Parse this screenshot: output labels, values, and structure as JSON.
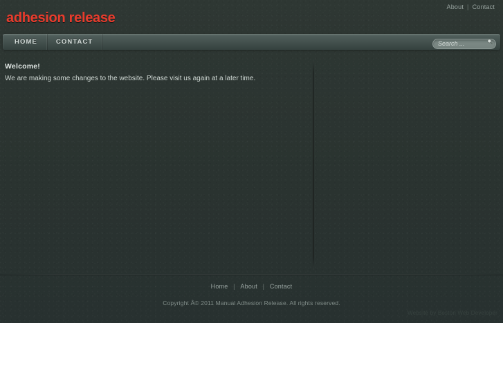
{
  "site": {
    "logo_text": "adhesion release",
    "logo_color": "#e83c2d",
    "background_color": "#2b3431"
  },
  "topbar": {
    "links": [
      {
        "label": "About"
      },
      {
        "label": "Contact"
      }
    ],
    "separator": "|"
  },
  "navbar": {
    "items": [
      {
        "label": "HOME"
      },
      {
        "label": "CONTACT"
      }
    ]
  },
  "search": {
    "value": "",
    "placeholder": "Search ...",
    "icon": "search-icon"
  },
  "main": {
    "welcome_title": "Welcome!",
    "welcome_body": "We are making some changes to the website. Please visit us again at a later time."
  },
  "footer": {
    "links": [
      {
        "label": "Home"
      },
      {
        "label": "About"
      },
      {
        "label": "Contact"
      }
    ],
    "separator": "|",
    "copyright": "Copyright Â© 2011 Manual Adhesion Release. All rights reserved.",
    "credit": "Website by Boston Web Developer"
  }
}
